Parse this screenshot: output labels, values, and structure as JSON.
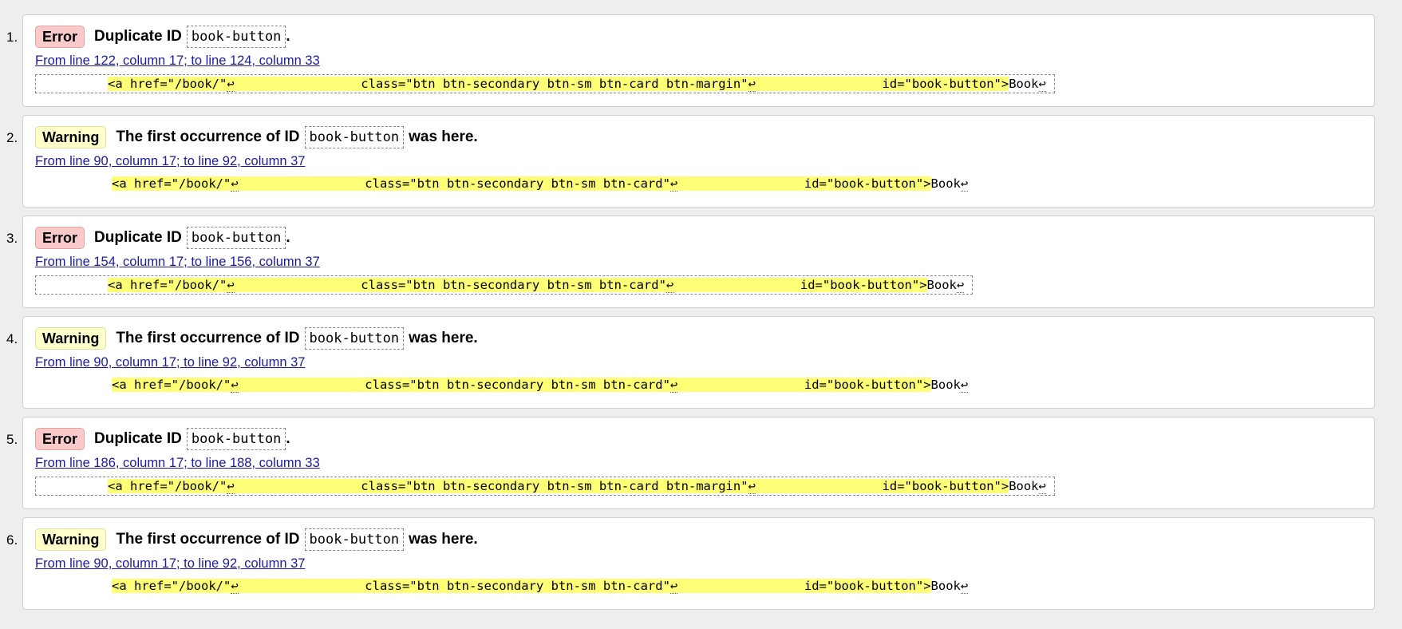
{
  "messages": [
    {
      "number": "1.",
      "type": "Error",
      "prefix": "Duplicate ID",
      "id": "book-button",
      "suffix": ".",
      "location": "From line 122, column 17; to line 124, column 33",
      "extract": {
        "part1": "<a href=\"/book/\"",
        "part2": "                 class=\"btn btn-secondary btn-sm btn-card btn-margin\"",
        "part3": "                 id=\"book-button\">",
        "tail": "Book",
        "return_glyph": "↩"
      }
    },
    {
      "number": "2.",
      "type": "Warning",
      "prefix": "The first occurrence of ID",
      "id": "book-button",
      "suffix": "was here.",
      "location": "From line 90, column 17; to line 92, column 37",
      "extract": {
        "part1": "<a href=\"/book/\"",
        "part2": "                 class=\"btn btn-secondary btn-sm btn-card\"",
        "part3": "                 id=\"book-button\">",
        "tail": "Book",
        "return_glyph": "↩"
      }
    },
    {
      "number": "3.",
      "type": "Error",
      "prefix": "Duplicate ID",
      "id": "book-button",
      "suffix": ".",
      "location": "From line 154, column 17; to line 156, column 37",
      "extract": {
        "part1": "<a href=\"/book/\"",
        "part2": "                 class=\"btn btn-secondary btn-sm btn-card\"",
        "part3": "                 id=\"book-button\">",
        "tail": "Book",
        "return_glyph": "↩"
      }
    },
    {
      "number": "4.",
      "type": "Warning",
      "prefix": "The first occurrence of ID",
      "id": "book-button",
      "suffix": "was here.",
      "location": "From line 90, column 17; to line 92, column 37",
      "extract": {
        "part1": "<a href=\"/book/\"",
        "part2": "                 class=\"btn btn-secondary btn-sm btn-card\"",
        "part3": "                 id=\"book-button\">",
        "tail": "Book",
        "return_glyph": "↩"
      }
    },
    {
      "number": "5.",
      "type": "Error",
      "prefix": "Duplicate ID",
      "id": "book-button",
      "suffix": ".",
      "location": "From line 186, column 17; to line 188, column 33",
      "extract": {
        "part1": "<a href=\"/book/\"",
        "part2": "                 class=\"btn btn-secondary btn-sm btn-card btn-margin\"",
        "part3": "                 id=\"book-button\">",
        "tail": "Book",
        "return_glyph": "↩"
      }
    },
    {
      "number": "6.",
      "type": "Warning",
      "prefix": "The first occurrence of ID",
      "id": "book-button",
      "suffix": "was here.",
      "location": "From line 90, column 17; to line 92, column 37",
      "extract": {
        "part1": "<a href=\"/book/\"",
        "part2": "                 class=\"btn btn-secondary btn-sm btn-card\"",
        "part3": "                 id=\"book-button\">",
        "tail": "Book",
        "return_glyph": "↩"
      }
    }
  ]
}
